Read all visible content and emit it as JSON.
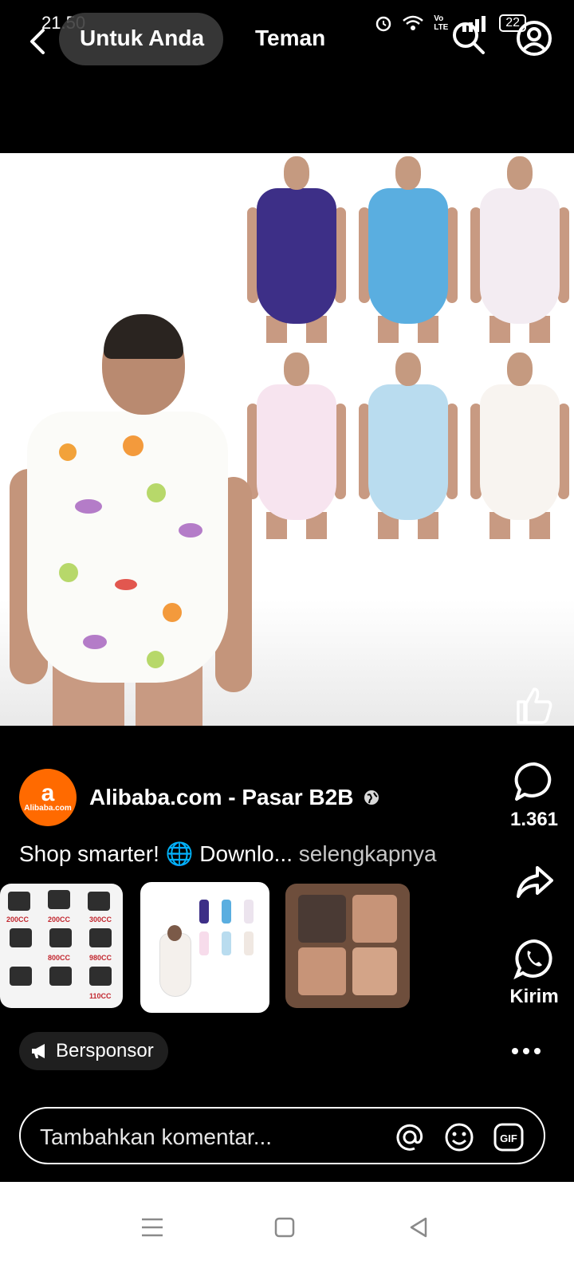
{
  "status_bar": {
    "time": "21.50",
    "battery": "22",
    "network": "Vo LTE"
  },
  "top_nav": {
    "tab_for_you": "Untuk Anda",
    "tab_friends": "Teman",
    "active_tab": "Untuk Anda"
  },
  "post": {
    "author": "Alibaba.com - Pasar B2B",
    "avatar_text": "Alibaba.com",
    "caption": "Shop smarter! 🌐 Downlo...",
    "see_more": "selengkapnya",
    "sponsored_label": "Bersponsor",
    "comments_count": "1.361",
    "send_label": "Kirim"
  },
  "thumb_1_labels": [
    "200CC",
    "300CC",
    "800CC",
    "980CC",
    "110CC"
  ],
  "comment_input": {
    "placeholder": "Tambahkan komentar..."
  },
  "icons": {
    "back": "back-arrow-icon",
    "search": "search-icon",
    "profile": "profile-icon",
    "like": "thumbs-up-icon",
    "comment": "comment-bubble-icon",
    "share": "share-arrow-icon",
    "send": "whatsapp-icon",
    "mention": "at-icon",
    "emoji": "emoji-icon",
    "gif": "gif-icon"
  },
  "colors": {
    "brand_alibaba": "#ff6a00",
    "background": "#000000"
  }
}
